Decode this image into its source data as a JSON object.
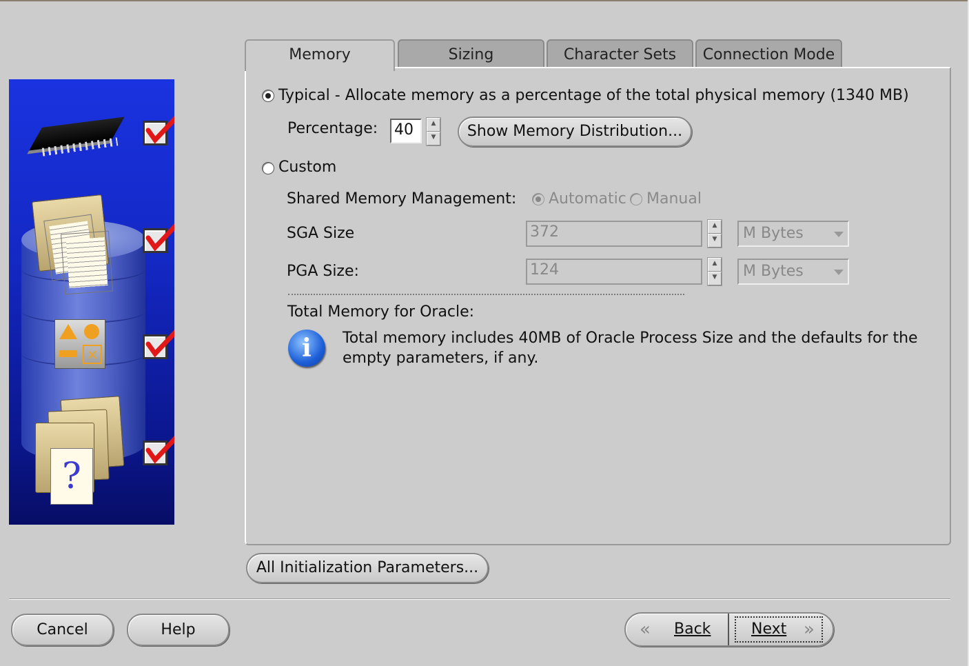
{
  "tabs": [
    {
      "label": "Memory",
      "active": true
    },
    {
      "label": "Sizing",
      "active": false
    },
    {
      "label": "Character Sets",
      "active": false
    },
    {
      "label": "Connection Mode",
      "active": false
    }
  ],
  "memory": {
    "typical_label": "Typical - Allocate memory as a percentage of the total physical memory (1340 MB)",
    "typical_selected": true,
    "percentage_label": "Percentage:",
    "percentage_value": "40",
    "show_distribution_button": "Show Memory Distribution...",
    "custom_label": "Custom",
    "custom_selected": false,
    "shared_memory_label": "Shared Memory Management:",
    "automatic_label": "Automatic",
    "manual_label": "Manual",
    "sga_label": "SGA Size",
    "sga_value": "372",
    "sga_unit": "M Bytes",
    "pga_label": "PGA Size:",
    "pga_value": "124",
    "pga_unit": "M Bytes",
    "total_label": "Total Memory for Oracle:",
    "info_text_line1": "Total memory includes 40MB of Oracle Process Size and the defaults for the",
    "info_text_line2": "empty parameters, if any."
  },
  "buttons": {
    "all_params": "All Initialization Parameters...",
    "cancel": "Cancel",
    "help": "Help",
    "back": "Back",
    "next": "Next"
  },
  "side_panel": {
    "icons": [
      "memory-chip-icon",
      "database-documents-icon",
      "shapes-icon",
      "help-documents-icon"
    ],
    "checked_steps": 4
  }
}
